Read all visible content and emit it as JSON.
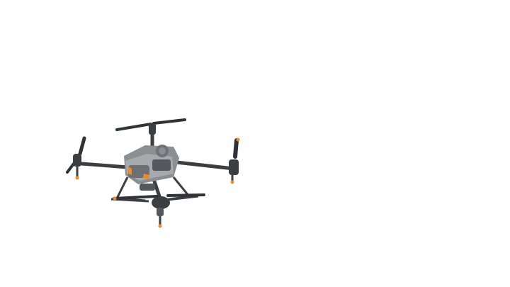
{
  "image": {
    "subject_icon": "agricultural-spray-drone",
    "colors": {
      "background": "#ffffff",
      "body": "#8c8f92",
      "body_dark": "#54585c",
      "arm": "#3b3e42",
      "accent": "#f08a24",
      "propeller": "#2f3236"
    }
  }
}
